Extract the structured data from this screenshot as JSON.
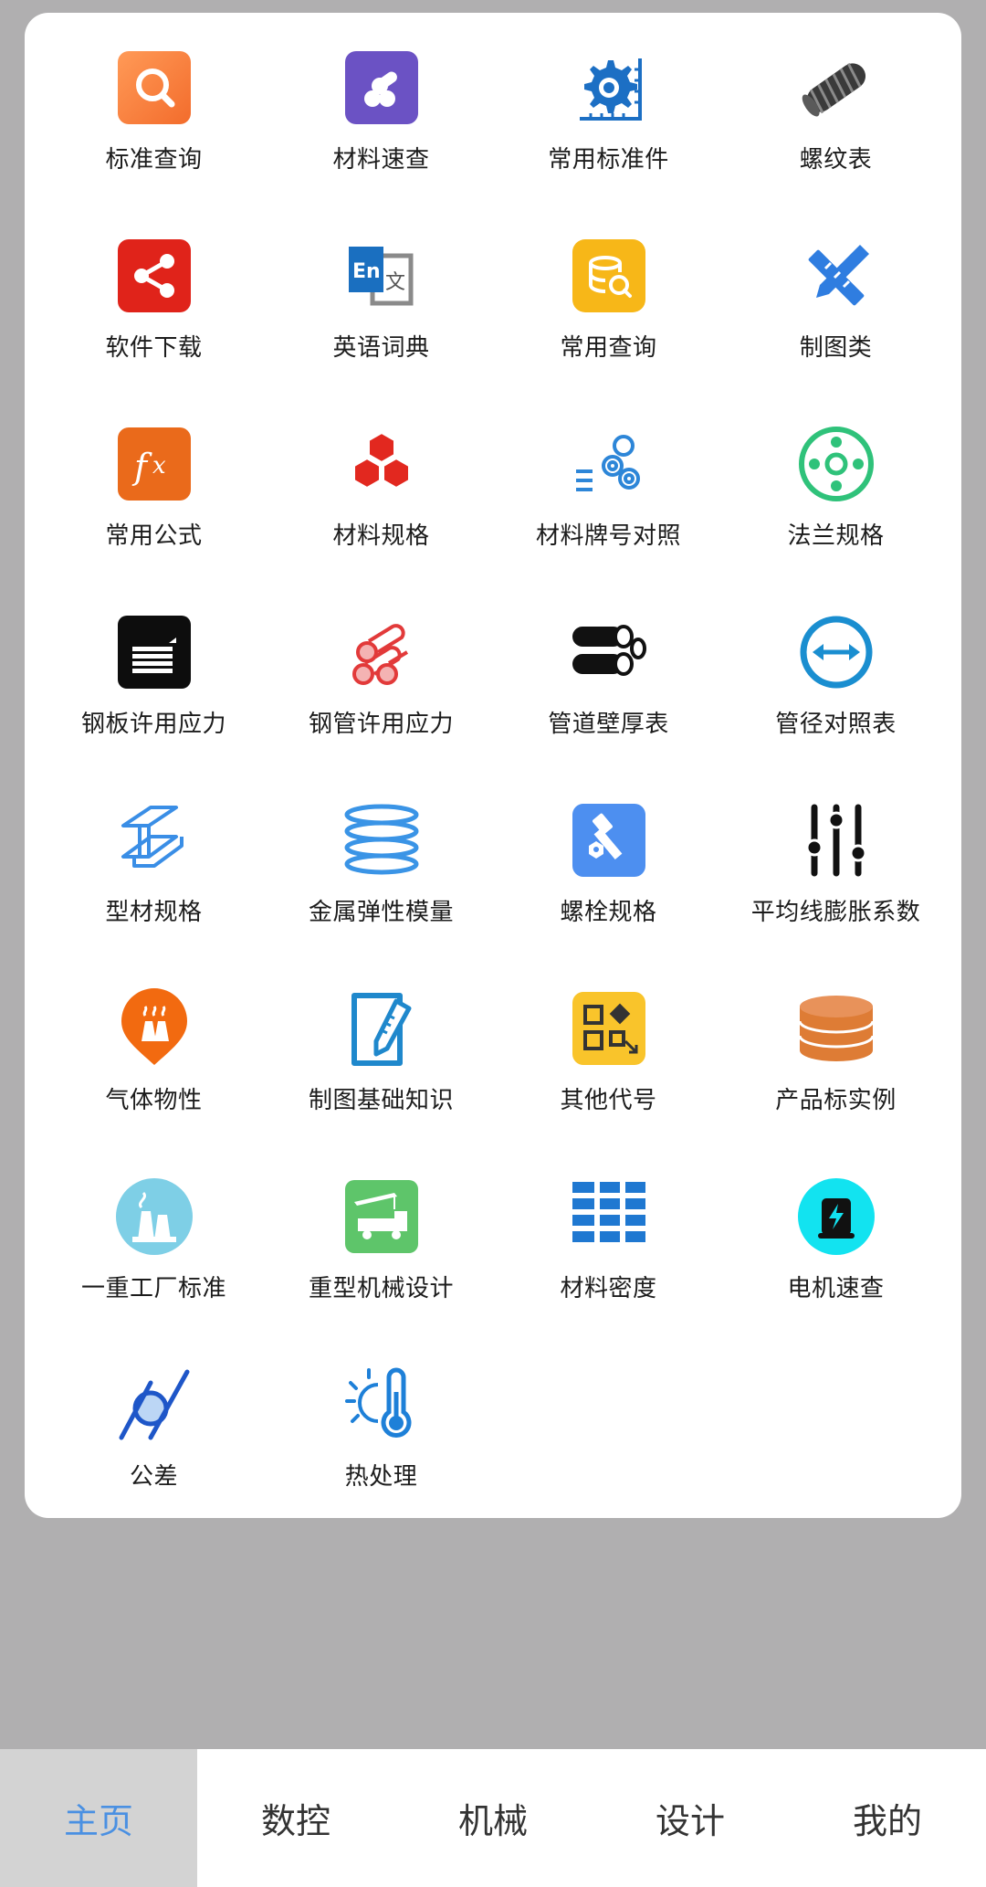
{
  "grid": {
    "items": [
      {
        "label": "标准查询",
        "icon": "search-icon"
      },
      {
        "label": "材料速查",
        "icon": "material-rods-icon"
      },
      {
        "label": "常用标准件",
        "icon": "gear-ruler-icon"
      },
      {
        "label": "螺纹表",
        "icon": "thread-screw-icon"
      },
      {
        "label": "软件下载",
        "icon": "share-icon"
      },
      {
        "label": "英语词典",
        "icon": "dictionary-translate-icon"
      },
      {
        "label": "常用查询",
        "icon": "database-search-icon"
      },
      {
        "label": "制图类",
        "icon": "pencil-ruler-icon"
      },
      {
        "label": "常用公式",
        "icon": "formula-fx-icon"
      },
      {
        "label": "材料规格",
        "icon": "cubes-icon"
      },
      {
        "label": "材料牌号对照",
        "icon": "pipes-list-icon"
      },
      {
        "label": "法兰规格",
        "icon": "flange-icon"
      },
      {
        "label": "钢板许用应力",
        "icon": "steel-plate-icon"
      },
      {
        "label": "钢管许用应力",
        "icon": "steel-pipes-icon"
      },
      {
        "label": "管道壁厚表",
        "icon": "pipe-wall-icon"
      },
      {
        "label": "管径对照表",
        "icon": "pipe-diameter-icon"
      },
      {
        "label": "型材规格",
        "icon": "i-beam-icon"
      },
      {
        "label": "金属弹性模量",
        "icon": "stacked-discs-icon"
      },
      {
        "label": "螺栓规格",
        "icon": "bolt-nut-icon"
      },
      {
        "label": "平均线膨胀系数",
        "icon": "sliders-icon"
      },
      {
        "label": "气体物性",
        "icon": "gas-plant-icon"
      },
      {
        "label": "制图基础知识",
        "icon": "drafting-pencil-icon"
      },
      {
        "label": "其他代号",
        "icon": "code-blocks-icon"
      },
      {
        "label": "产品标实例",
        "icon": "database-icon"
      },
      {
        "label": "一重工厂标准",
        "icon": "factory-icon"
      },
      {
        "label": "重型机械设计",
        "icon": "crane-truck-icon"
      },
      {
        "label": "材料密度",
        "icon": "density-grid-icon"
      },
      {
        "label": "电机速查",
        "icon": "motor-icon"
      },
      {
        "label": "公差",
        "icon": "tolerance-icon"
      },
      {
        "label": "热处理",
        "icon": "heat-treatment-icon"
      }
    ]
  },
  "bottom_nav": {
    "tabs": [
      {
        "label": "主页",
        "active": true
      },
      {
        "label": "数控",
        "active": false
      },
      {
        "label": "机械",
        "active": false
      },
      {
        "label": "设计",
        "active": false
      },
      {
        "label": "我的",
        "active": false
      }
    ]
  },
  "colors": {
    "background": "#b0afb0",
    "active_tab_text": "#4a90e2",
    "active_tab_bg": "#d3d3d3"
  }
}
